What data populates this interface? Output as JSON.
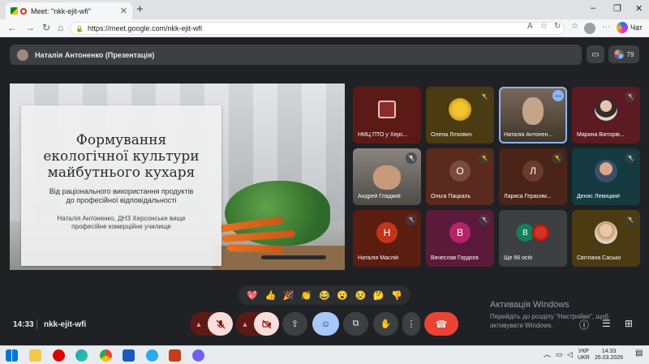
{
  "browser": {
    "tab_title": "Meet: \"nkk-ejit-wfi\"",
    "tab_close": "✕",
    "new_tab": "+",
    "url": "https://meet.google.com/nkk-ejit-wfi",
    "copilot_label": "Чат",
    "window_controls": [
      "–",
      "❐",
      "✕"
    ]
  },
  "meet": {
    "presenter_banner": "Наталія Антоненко (Презентація)",
    "participant_count": "79",
    "slide": {
      "title_line1": "Формування",
      "title_line2": "екологічної культури",
      "title_line3": "майбутнього кухаря",
      "subtitle_line1": "Від раціонального використання продуктів",
      "subtitle_line2": "до професійної відповідальності",
      "author_line1": "Наталія Антоненко, ДНЗ Херсонське вище",
      "author_line2": "професійне комерційне училище"
    },
    "tiles": [
      {
        "name": "НМЦ ПТО у Херс...",
        "bg": "#5c1a17",
        "muted": false
      },
      {
        "name": "Олена Літкович",
        "bg": "#4a3b12",
        "muted": true
      },
      {
        "name": "Наталія Антонен...",
        "bg": "#5a4a3a",
        "muted": false,
        "active": true
      },
      {
        "name": "Марина Вікторів...",
        "bg": "#5c1a22",
        "muted": true
      },
      {
        "name": "Андрей Гладкий",
        "bg": "#6b6560",
        "muted": true
      },
      {
        "name": "Ольга Пацкаль",
        "bg": "#5a2a1e",
        "muted": true,
        "initial": "О",
        "initial_bg": "#7b4a3c"
      },
      {
        "name": "Лариса Герасим...",
        "bg": "#4a2418",
        "muted": true,
        "initial": "Л",
        "initial_bg": "#6b3b2c"
      },
      {
        "name": "Денис Левицкий",
        "bg": "#153a3f",
        "muted": true
      },
      {
        "name": "Наталія Маслій",
        "bg": "#5a1d10",
        "muted": true,
        "initial": "Н",
        "initial_bg": "#c1361b"
      },
      {
        "name": "Вячеслав Гордєєв",
        "bg": "#5c1a3a",
        "muted": true,
        "initial": "В",
        "initial_bg": "#b3246a"
      },
      {
        "name": "Ще 66 осіб",
        "bg": "#3c4043",
        "muted": false,
        "stack": [
          "В",
          ""
        ]
      },
      {
        "name": "Світлана Сасько",
        "bg": "#4a3b12",
        "muted": true
      }
    ],
    "reactions": [
      "💖",
      "👍",
      "🎉",
      "👏",
      "😂",
      "😮",
      "😢",
      "🤔",
      "👎"
    ],
    "time": "14:33",
    "meeting_code": "nkk-ejit-wfi",
    "watermark_title": "Активація Windows",
    "watermark_line1": "Перейдіть до розділу \"Настройки\", щоб",
    "watermark_line2": "активувати Windows."
  },
  "taskbar": {
    "lang": "УКР",
    "lang2": "UKR",
    "clock_time": "14:33",
    "clock_date": "26.03.2026"
  },
  "colors": {
    "meet_bg": "#202124",
    "end_call": "#ea4335",
    "accent": "#8ab4f8"
  }
}
